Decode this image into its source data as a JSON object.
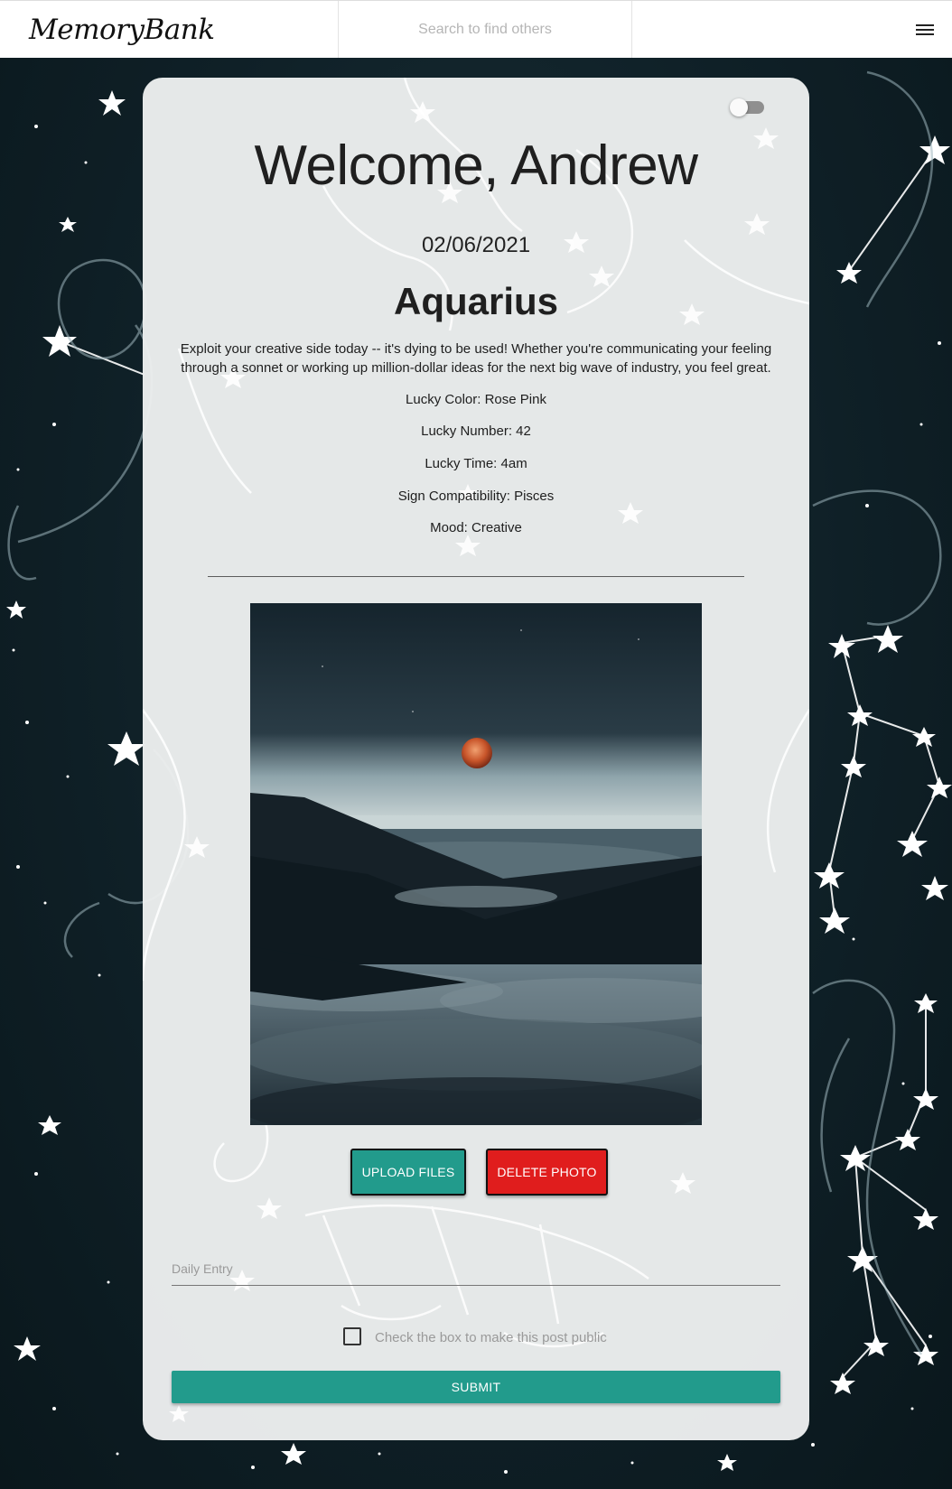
{
  "app": {
    "brand": "MemoryBank"
  },
  "search": {
    "placeholder": "Search to find others"
  },
  "header": {
    "menu_icon": "hamburger-menu-icon"
  },
  "card": {
    "welcome": "Welcome, Andrew",
    "date": "02/06/2021",
    "sign": "Aquarius",
    "horoscope": "Exploit your creative side today -- it's dying to be used! Whether you're communicating your feeling through a sonnet or working up million-dollar ideas for the next big wave of industry, you feel great.",
    "lucky_color": "Lucky Color: Rose Pink",
    "lucky_number": "Lucky Number: 42",
    "lucky_time": "Lucky Time: 4am",
    "compatibility": "Sign Compatibility: Pisces",
    "mood": "Mood: Creative",
    "theme_toggle": {
      "on": false
    }
  },
  "actions": {
    "upload_label": "UPLOAD FILES",
    "delete_label": "DELETE PHOTO"
  },
  "entry": {
    "placeholder": "Daily Entry",
    "value": ""
  },
  "public_checkbox": {
    "label": "Check the box to make this post public",
    "checked": false
  },
  "submit_label": "SUBMIT",
  "colors": {
    "accent": "#229b8c",
    "danger": "#e01d1d",
    "card": "#eceeee"
  }
}
